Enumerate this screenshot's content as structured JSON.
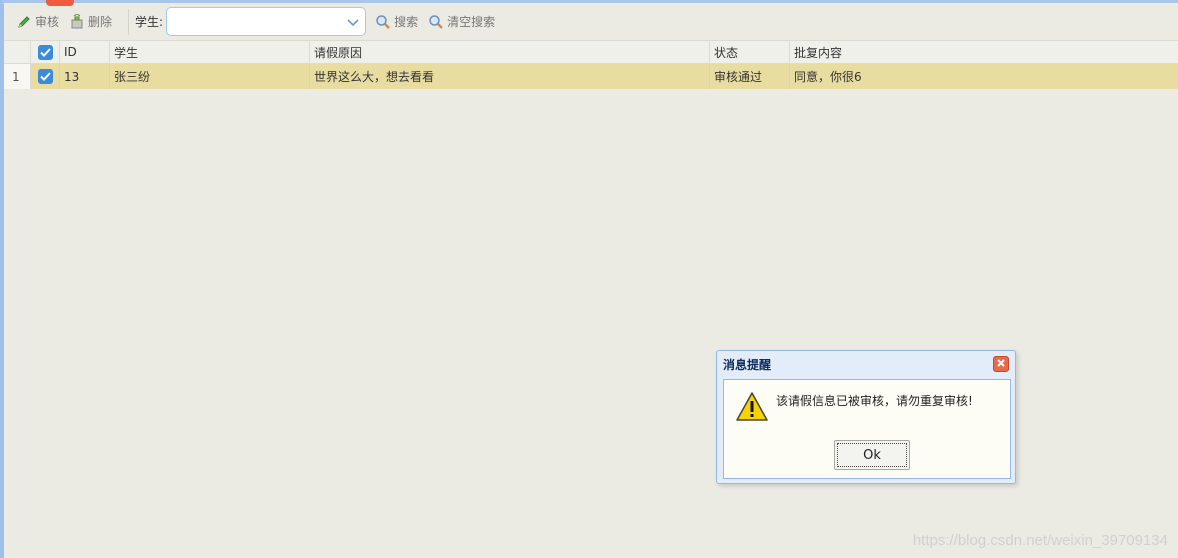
{
  "toolbar": {
    "audit_label": "审核",
    "delete_label": "删除",
    "student_label": "学生:",
    "student_value": "",
    "search_label": "搜索",
    "clear_search_label": "清空搜索"
  },
  "grid": {
    "columns": [
      "ID",
      "学生",
      "请假原因",
      "状态",
      "批复内容"
    ],
    "rows": [
      {
        "row_number": "1",
        "checked": true,
        "cells": [
          "13",
          "张三纷",
          "世界这么大，想去看看",
          "审核通过",
          "同意，你很6"
        ]
      }
    ]
  },
  "dialog": {
    "title": "消息提醒",
    "message": "该请假信息已被审核，请勿重复审核!",
    "ok_label": "Ok"
  },
  "watermark": "https://blog.csdn.net/weixin_39709134",
  "colors": {
    "accent": "#3a8bd9",
    "selected_row": "#e8dca0",
    "dialog_border": "#95b8e7"
  }
}
